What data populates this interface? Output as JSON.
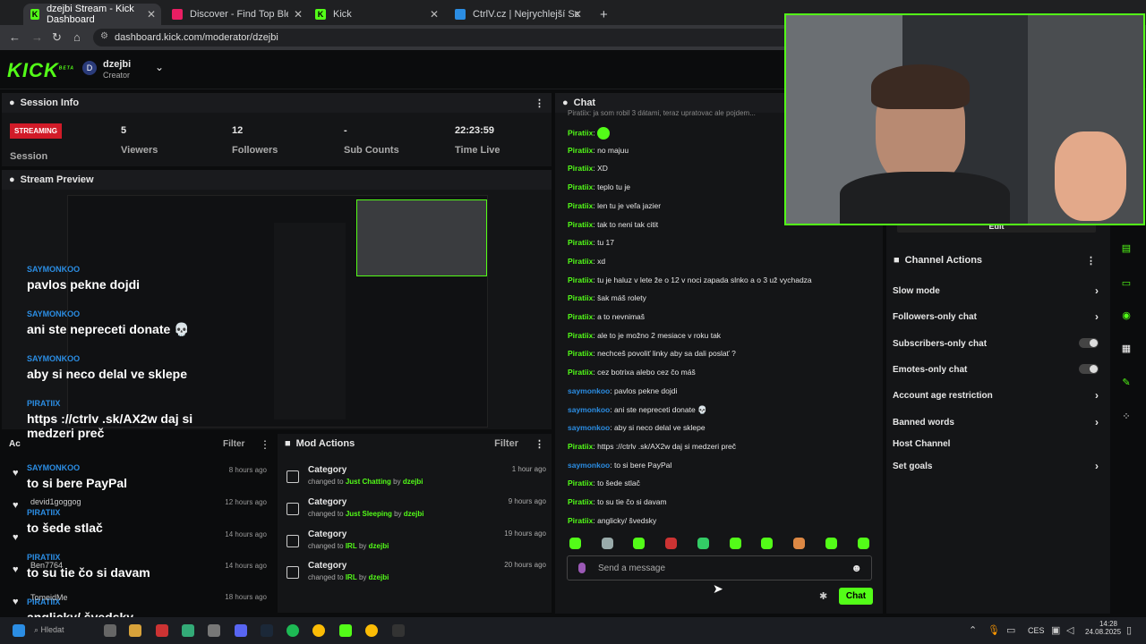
{
  "browser": {
    "tabs": [
      {
        "label": "dzejbi Stream - Kick Dashboard",
        "active": true,
        "color": "#53fc18"
      },
      {
        "label": "Discover - Find Top Blerps, Stre",
        "active": false,
        "color": "#e91e63"
      },
      {
        "label": "Kick",
        "active": false,
        "color": "#53fc18"
      },
      {
        "label": "CtrlV.cz | Nejrychlejší ScreenSh",
        "active": false,
        "color": "#2b8de3"
      }
    ],
    "url": "dashboard.kick.com/moderator/dzejbi"
  },
  "header": {
    "logo": "KICK",
    "logo_beta": "BETA",
    "avatar_letter": "D",
    "username": "dzejbi",
    "role": "Creator"
  },
  "session": {
    "title": "Session Info",
    "badge": "STREAMING",
    "session_label": "Session",
    "stats": [
      {
        "value": "5",
        "label": "Viewers"
      },
      {
        "value": "12",
        "label": "Followers"
      },
      {
        "value": "-",
        "label": "Sub Counts"
      },
      {
        "value": "22:23:59",
        "label": "Time Live"
      }
    ]
  },
  "preview": {
    "title": "Stream Preview"
  },
  "overlay_chat": [
    {
      "user": "SAYMONKOO",
      "msg": "pavlos pekne dojdi"
    },
    {
      "user": "SAYMONKOO",
      "msg": "ani ste nepreceti donate 💀"
    },
    {
      "user": "SAYMONKOO",
      "msg": "aby si neco delal ve sklepe"
    },
    {
      "user": "PIRATIIX",
      "msg": "https ://ctrlv .sk/AX2w daj si medzeri preč"
    },
    {
      "user": "SAYMONKOO",
      "msg": "to si bere PayPal"
    },
    {
      "user": "PIRATIIX",
      "msg": "to šede stlač"
    },
    {
      "user": "PIRATIIX",
      "msg": "to su tie čo si davam"
    },
    {
      "user": "PIRATIIX",
      "msg": "anglicky/ švedsky"
    }
  ],
  "activity": {
    "title": "Ac",
    "filter": "Filter",
    "times": [
      "8 hours ago",
      "12 hours ago",
      "14 hours ago",
      "14 hours ago",
      "18 hours ago"
    ],
    "names": [
      "devid1goggog",
      "Ben7764",
      "TomeidMe"
    ]
  },
  "mod_actions": {
    "title": "Mod Actions",
    "filter": "Filter",
    "items": [
      {
        "title": "Category",
        "prefix": "changed to",
        "category": "Just Chatting",
        "by": "by",
        "user": "dzejbi",
        "time": "1 hour ago"
      },
      {
        "title": "Category",
        "prefix": "changed to",
        "category": "Just Sleeping",
        "by": "by",
        "user": "dzejbi",
        "time": "9 hours ago"
      },
      {
        "title": "Category",
        "prefix": "changed to",
        "category": "IRL",
        "by": "by",
        "user": "dzejbi",
        "time": "19 hours ago"
      },
      {
        "title": "Category",
        "prefix": "changed to",
        "category": "IRL",
        "by": "by",
        "user": "dzejbi",
        "time": "20 hours ago"
      }
    ]
  },
  "chat": {
    "title": "Chat",
    "top_partial": "Piratiix: ja som robil 3 dátami, teraz upratovac ale pojdem...",
    "messages": [
      {
        "user": "Piratiix",
        "text": "",
        "emote": true,
        "blue": false
      },
      {
        "user": "Piratiix",
        "text": "no majuu",
        "blue": false
      },
      {
        "user": "Piratiix",
        "text": "XD",
        "blue": false
      },
      {
        "user": "Piratiix",
        "text": "teplo tu je",
        "blue": false
      },
      {
        "user": "Piratiix",
        "text": "len tu je veľa jazier",
        "blue": false
      },
      {
        "user": "Piratiix",
        "text": "tak to neni tak citit",
        "blue": false
      },
      {
        "user": "Piratiix",
        "text": "tu 17",
        "blue": false
      },
      {
        "user": "Piratiix",
        "text": "xd",
        "blue": false
      },
      {
        "user": "Piratiix",
        "text": "tu je haluz v lete že o 12 v noci zapada slnko a o 3 už vychadza",
        "blue": false
      },
      {
        "user": "Piratiix",
        "text": "šak máš rolety",
        "blue": false
      },
      {
        "user": "Piratiix",
        "text": "a to nevnimaš",
        "blue": false
      },
      {
        "user": "Piratiix",
        "text": "ale to je možno 2 mesiace v roku tak",
        "blue": false
      },
      {
        "user": "Piratiix",
        "text": "nechceš povoliť linky aby sa dali poslať ?",
        "blue": false
      },
      {
        "user": "Piratiix",
        "text": "cez botrixa alebo cez čo máš",
        "blue": false
      },
      {
        "user": "saymonkoo",
        "text": "pavlos pekne dojdi",
        "blue": true
      },
      {
        "user": "saymonkoo",
        "text": "ani ste nepreceti donate 💀",
        "blue": true
      },
      {
        "user": "saymonkoo",
        "text": "aby si neco delal ve sklepe",
        "blue": true
      },
      {
        "user": "Piratiix",
        "text": "https ://ctrlv .sk/AX2w daj si medzeri preč",
        "blue": false
      },
      {
        "user": "saymonkoo",
        "text": "to si bere PayPal",
        "blue": true
      },
      {
        "user": "Piratiix",
        "text": "to šede stlač",
        "blue": false
      },
      {
        "user": "Piratiix",
        "text": "to su tie čo si davam",
        "blue": false
      },
      {
        "user": "Piratiix",
        "text": "anglicky/ švedsky",
        "blue": false
      }
    ],
    "placeholder": "Send a message",
    "send_label": "Chat"
  },
  "channel_actions": {
    "edit": "Edit",
    "title": "Channel Actions",
    "items": [
      {
        "label": "Slow mode",
        "control": "chevron"
      },
      {
        "label": "Followers-only chat",
        "control": "chevron"
      },
      {
        "label": "Subscribers-only chat",
        "control": "toggle"
      },
      {
        "label": "Emotes-only chat",
        "control": "toggle"
      },
      {
        "label": "Account age restriction",
        "control": "chevron"
      },
      {
        "label": "Banned words",
        "control": "chevron"
      },
      {
        "label": "Host Channel",
        "control": "none"
      },
      {
        "label": "Set goals",
        "control": "chevron"
      }
    ]
  },
  "taskbar": {
    "search": "Hledat",
    "lang": "CES",
    "time": "14:28",
    "date": "24.08.2025"
  },
  "colors": {
    "accent": "#53fc18",
    "live": "#d11b28",
    "blue_user": "#2b8de3"
  }
}
